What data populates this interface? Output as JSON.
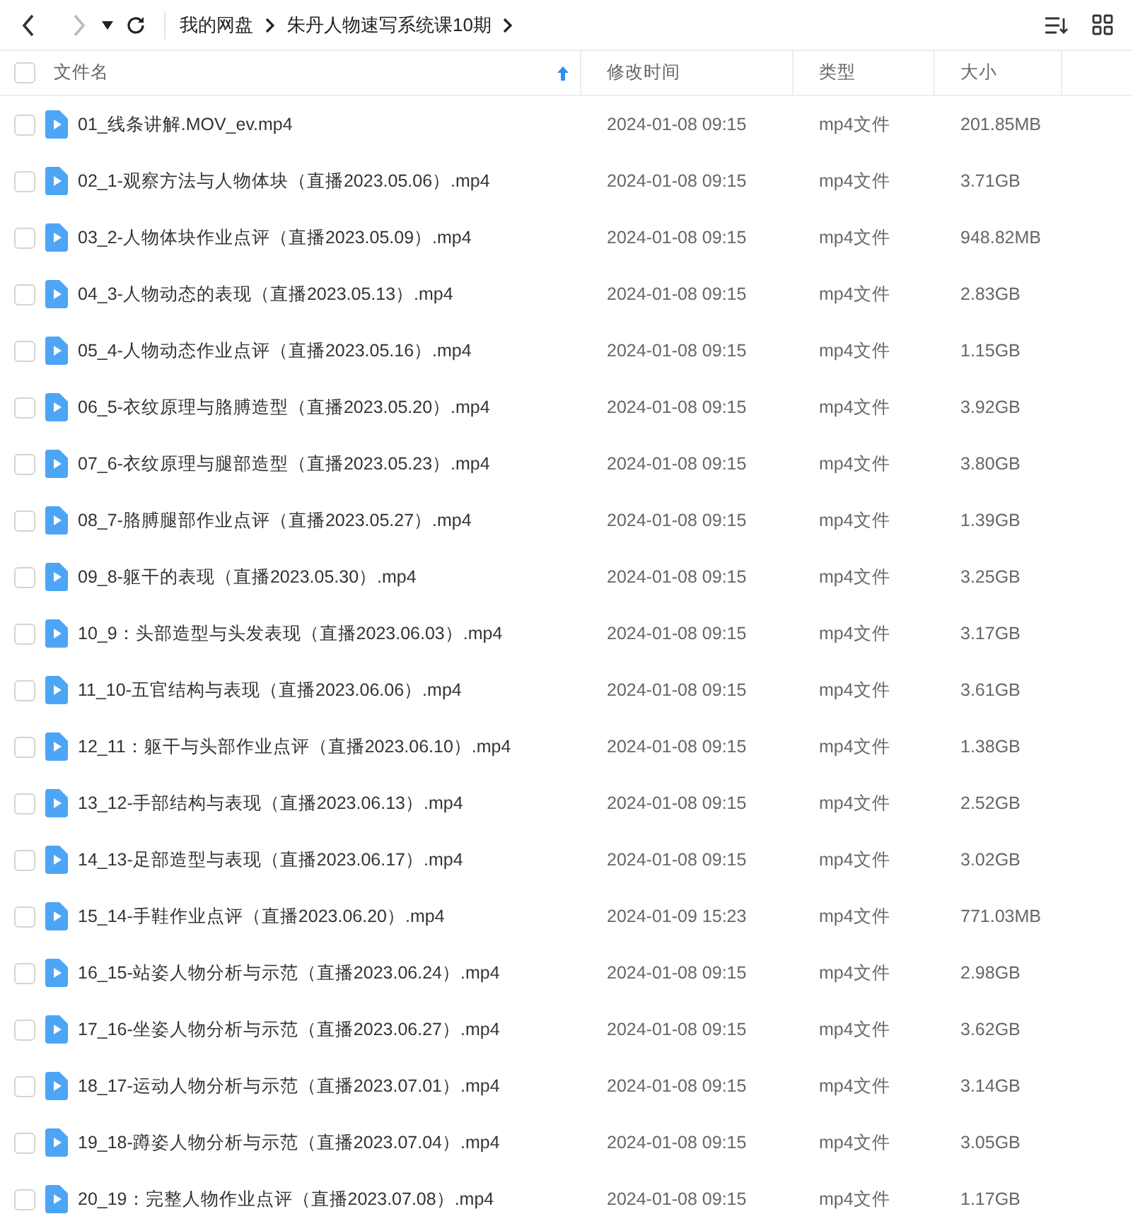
{
  "toolbar": {
    "breadcrumbs": [
      "我的网盘",
      "朱丹人物速写系统课10期"
    ]
  },
  "table": {
    "select_all": {
      "checked": false
    },
    "columns": [
      {
        "label": "文件名",
        "sorted": true
      },
      {
        "label": "修改时间",
        "sorted": false
      },
      {
        "label": "类型",
        "sorted": false
      },
      {
        "label": "大小",
        "sorted": false
      }
    ],
    "rows": [
      {
        "checked": false,
        "name": "01_线条讲解.MOV_ev.mp4",
        "modified": "2024-01-08 09:15",
        "type": "mp4文件",
        "size": "201.85MB"
      },
      {
        "checked": false,
        "name": "02_1-观察方法与人物体块（直播2023.05.06）.mp4",
        "modified": "2024-01-08 09:15",
        "type": "mp4文件",
        "size": "3.71GB"
      },
      {
        "checked": false,
        "name": "03_2-人物体块作业点评（直播2023.05.09）.mp4",
        "modified": "2024-01-08 09:15",
        "type": "mp4文件",
        "size": "948.82MB"
      },
      {
        "checked": false,
        "name": "04_3-人物动态的表现（直播2023.05.13）.mp4",
        "modified": "2024-01-08 09:15",
        "type": "mp4文件",
        "size": "2.83GB"
      },
      {
        "checked": false,
        "name": "05_4-人物动态作业点评（直播2023.05.16）.mp4",
        "modified": "2024-01-08 09:15",
        "type": "mp4文件",
        "size": "1.15GB"
      },
      {
        "checked": false,
        "name": "06_5-衣纹原理与胳膊造型（直播2023.05.20）.mp4",
        "modified": "2024-01-08 09:15",
        "type": "mp4文件",
        "size": "3.92GB"
      },
      {
        "checked": false,
        "name": "07_6-衣纹原理与腿部造型（直播2023.05.23）.mp4",
        "modified": "2024-01-08 09:15",
        "type": "mp4文件",
        "size": "3.80GB"
      },
      {
        "checked": false,
        "name": "08_7-胳膊腿部作业点评（直播2023.05.27）.mp4",
        "modified": "2024-01-08 09:15",
        "type": "mp4文件",
        "size": "1.39GB"
      },
      {
        "checked": false,
        "name": "09_8-躯干的表现（直播2023.05.30）.mp4",
        "modified": "2024-01-08 09:15",
        "type": "mp4文件",
        "size": "3.25GB"
      },
      {
        "checked": false,
        "name": "10_9：头部造型与头发表现（直播2023.06.03）.mp4",
        "modified": "2024-01-08 09:15",
        "type": "mp4文件",
        "size": "3.17GB"
      },
      {
        "checked": false,
        "name": "11_10-五官结构与表现（直播2023.06.06）.mp4",
        "modified": "2024-01-08 09:15",
        "type": "mp4文件",
        "size": "3.61GB"
      },
      {
        "checked": false,
        "name": "12_11：躯干与头部作业点评（直播2023.06.10）.mp4",
        "modified": "2024-01-08 09:15",
        "type": "mp4文件",
        "size": "1.38GB"
      },
      {
        "checked": false,
        "name": "13_12-手部结构与表现（直播2023.06.13）.mp4",
        "modified": "2024-01-08 09:15",
        "type": "mp4文件",
        "size": "2.52GB"
      },
      {
        "checked": false,
        "name": "14_13-足部造型与表现（直播2023.06.17）.mp4",
        "modified": "2024-01-08 09:15",
        "type": "mp4文件",
        "size": "3.02GB"
      },
      {
        "checked": false,
        "name": "15_14-手鞋作业点评（直播2023.06.20）.mp4",
        "modified": "2024-01-09 15:23",
        "type": "mp4文件",
        "size": "771.03MB"
      },
      {
        "checked": false,
        "name": "16_15-站姿人物分析与示范（直播2023.06.24）.mp4",
        "modified": "2024-01-08 09:15",
        "type": "mp4文件",
        "size": "2.98GB"
      },
      {
        "checked": false,
        "name": "17_16-坐姿人物分析与示范（直播2023.06.27）.mp4",
        "modified": "2024-01-08 09:15",
        "type": "mp4文件",
        "size": "3.62GB"
      },
      {
        "checked": false,
        "name": "18_17-运动人物分析与示范（直播2023.07.01）.mp4",
        "modified": "2024-01-08 09:15",
        "type": "mp4文件",
        "size": "3.14GB"
      },
      {
        "checked": false,
        "name": "19_18-蹲姿人物分析与示范（直播2023.07.04）.mp4",
        "modified": "2024-01-08 09:15",
        "type": "mp4文件",
        "size": "3.05GB"
      },
      {
        "checked": false,
        "name": "20_19：完整人物作业点评（直播2023.07.08）.mp4",
        "modified": "2024-01-08 09:15",
        "type": "mp4文件",
        "size": "1.17GB"
      }
    ]
  }
}
